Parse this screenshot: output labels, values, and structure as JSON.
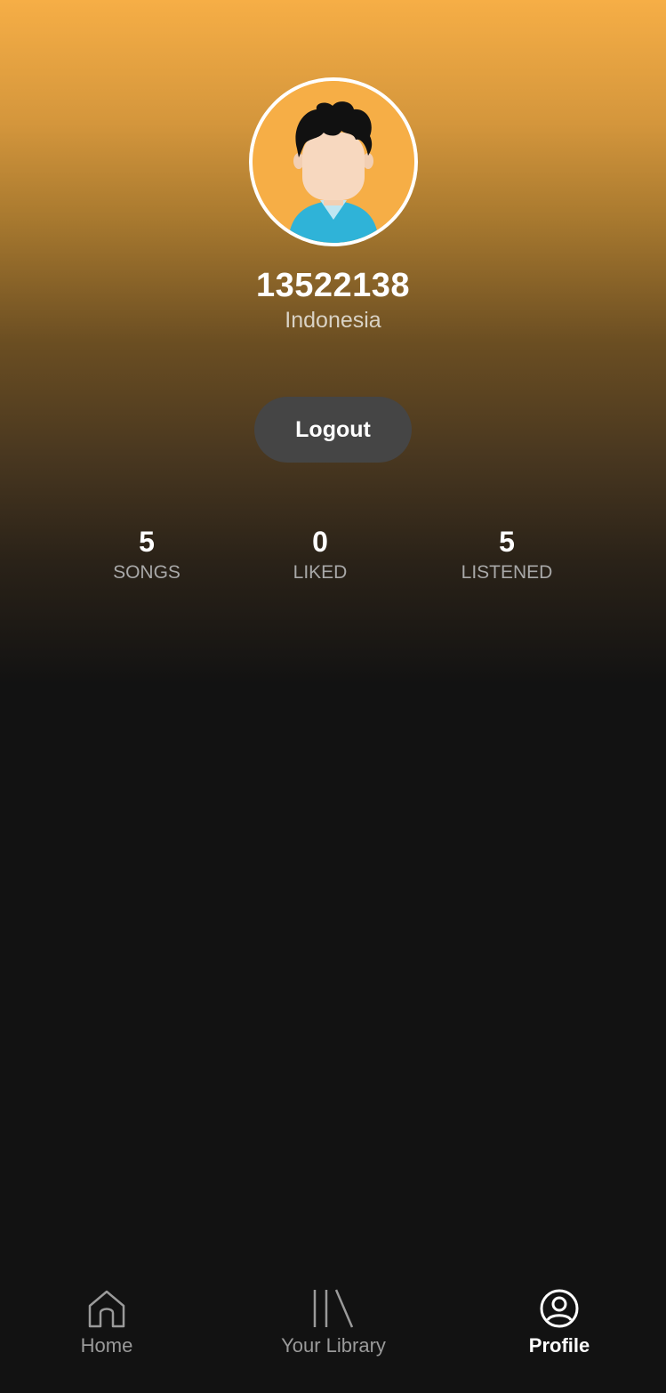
{
  "profile": {
    "username": "13522138",
    "country": "Indonesia",
    "logout_label": "Logout",
    "avatar_icon": "user-avatar-icon"
  },
  "stats": {
    "songs": {
      "value": "5",
      "label": "SONGS"
    },
    "liked": {
      "value": "0",
      "label": "LIKED"
    },
    "listened": {
      "value": "5",
      "label": "LISTENED"
    }
  },
  "nav": {
    "home": {
      "label": "Home",
      "icon": "home-icon"
    },
    "library": {
      "label": "Your Library",
      "icon": "library-icon"
    },
    "profile": {
      "label": "Profile",
      "icon": "profile-icon",
      "active": true
    }
  },
  "colors": {
    "accent": "#f6ae46",
    "background": "#121212",
    "button": "#454545"
  }
}
